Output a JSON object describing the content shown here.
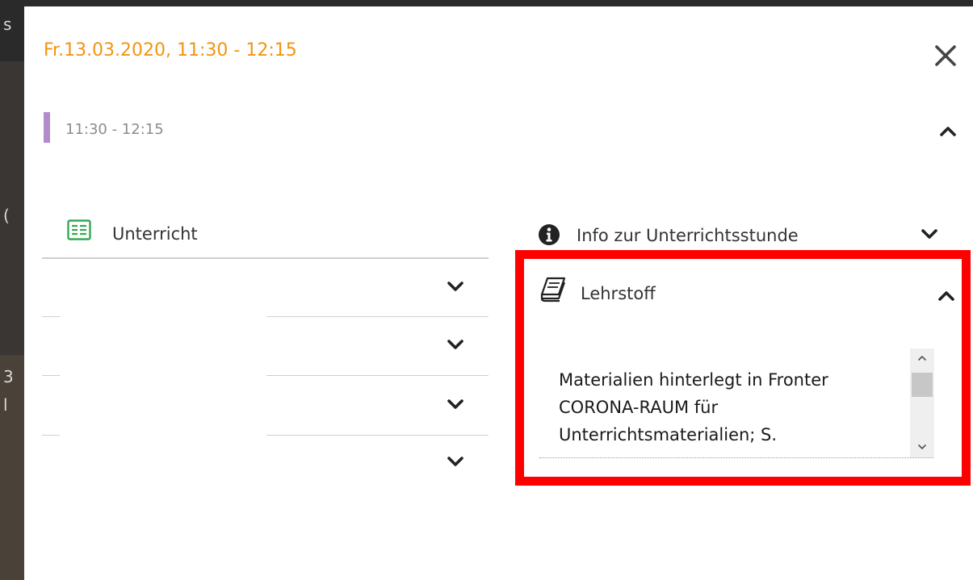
{
  "modal": {
    "title": "Fr.13.03.2020, 11:30 - 12:15",
    "title_color": "#f29410",
    "close_icon": "close-icon"
  },
  "period": {
    "time": "11:30 - 12:15",
    "color": "#b28dc9",
    "expanded": true
  },
  "unterricht": {
    "label": "Unterricht",
    "icon": "lesson-table-icon",
    "row_count": 4
  },
  "info": {
    "label": "Info zur Unterrichtsstunde",
    "icon": "info-icon",
    "expanded": false
  },
  "lehrstoff": {
    "label": "Lehrstoff",
    "icon": "book-icon",
    "expanded": true,
    "content": "Materialien hinterlegt in Fronter CORONA-RAUM für Unterrichtsmaterialien; S."
  },
  "highlight_color": "#ff0000"
}
